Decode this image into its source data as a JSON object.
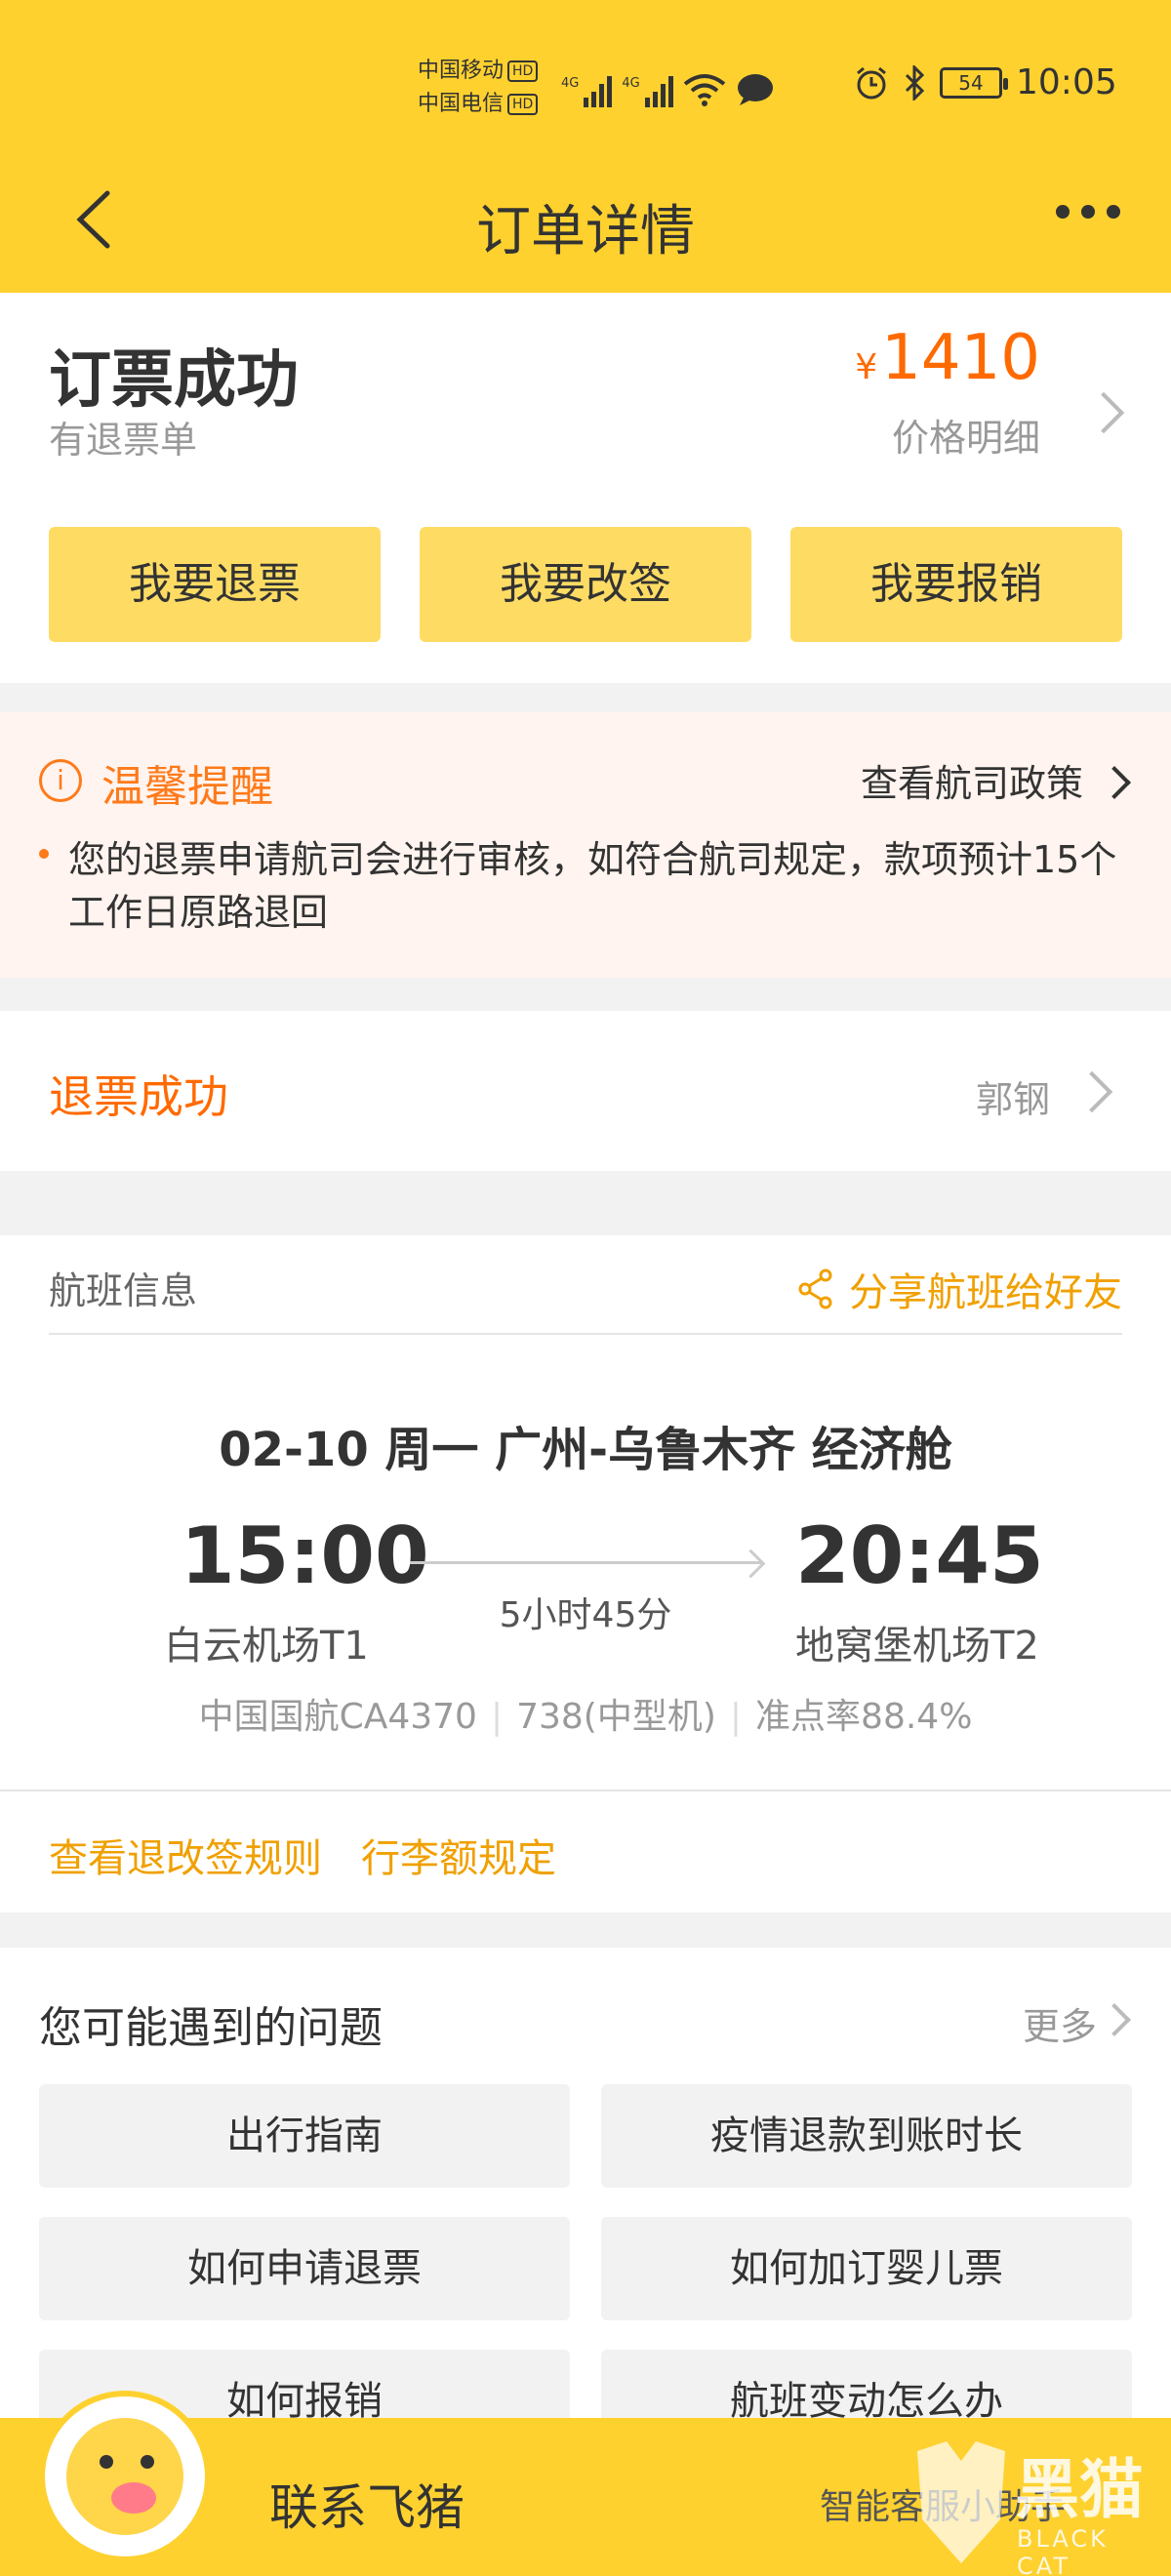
{
  "status_bar": {
    "carrier1": "中国移动",
    "carrier2": "中国电信",
    "hd": "HD",
    "net": "4G",
    "battery": "54",
    "time": "10:05"
  },
  "nav": {
    "title": "订单详情"
  },
  "order": {
    "status": "订票成功",
    "sub_status": "有退票单",
    "currency": "¥",
    "price": "1410",
    "price_detail": "价格明细",
    "buttons": [
      "我要退票",
      "我要改签",
      "我要报销"
    ]
  },
  "reminder": {
    "icon_text": "i",
    "title": "温馨提醒",
    "policy_link": "查看航司政策",
    "text": "您的退票申请航司会进行审核，如符合航司规定，款项预计15个工作日原路退回"
  },
  "refund": {
    "title": "退票成功",
    "person": "郭钢"
  },
  "flight": {
    "section_label": "航班信息",
    "share_label": "分享航班给好友",
    "route": "02-10  周一  广州-乌鲁木齐  经济舱",
    "dep_time": "15:00",
    "arr_time": "20:45",
    "duration": "5小时45分",
    "dep_airport": "白云机场T1",
    "arr_airport": "地窝堡机场T2",
    "flight_no": "中国国航CA4370",
    "aircraft": "738(中型机)",
    "on_time": "准点率88.4%",
    "rule_link": "查看退改签规则",
    "luggage_link": "行李额规定"
  },
  "questions": {
    "title": "您可能遇到的问题",
    "more": "更多",
    "items": [
      "出行指南",
      "疫情退款到账时长",
      "如何申请退票",
      "如何加订婴儿票",
      "如何报销",
      "航班变动怎么办"
    ]
  },
  "bottom": {
    "contact": "联系飞猪",
    "assistant": "智能客服小助手"
  },
  "watermark": {
    "text": "黑猫",
    "sub": "BLACK CAT"
  },
  "colors": {
    "brand_yellow": "#fed12f",
    "accent_orange": "#ff6a00",
    "link_gold": "#f0a000"
  }
}
